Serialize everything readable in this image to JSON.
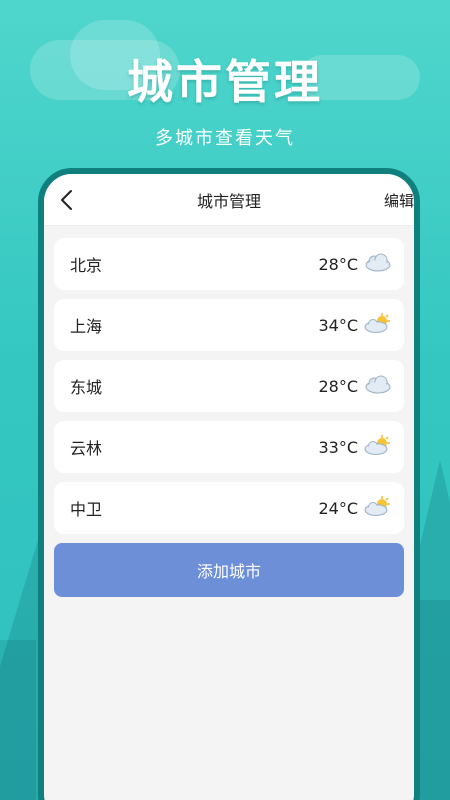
{
  "hero": {
    "title": "城市管理",
    "subtitle": "多城市查看天气"
  },
  "nav": {
    "title": "城市管理",
    "edit_label": "编辑",
    "back_icon": "chevron-left-icon"
  },
  "cities": [
    {
      "name": "北京",
      "temp": "28°C",
      "icon": "cloud-icon"
    },
    {
      "name": "上海",
      "temp": "34°C",
      "icon": "partly-sunny-icon"
    },
    {
      "name": "东城",
      "temp": "28°C",
      "icon": "cloud-icon"
    },
    {
      "name": "云林",
      "temp": "33°C",
      "icon": "partly-sunny-icon"
    },
    {
      "name": "中卫",
      "temp": "24°C",
      "icon": "partly-sunny-icon"
    }
  ],
  "add_button": {
    "label": "添加城市"
  },
  "colors": {
    "background": "#34c7c1",
    "phone_frame": "#10807f",
    "add_button": "#6c8fd8"
  }
}
